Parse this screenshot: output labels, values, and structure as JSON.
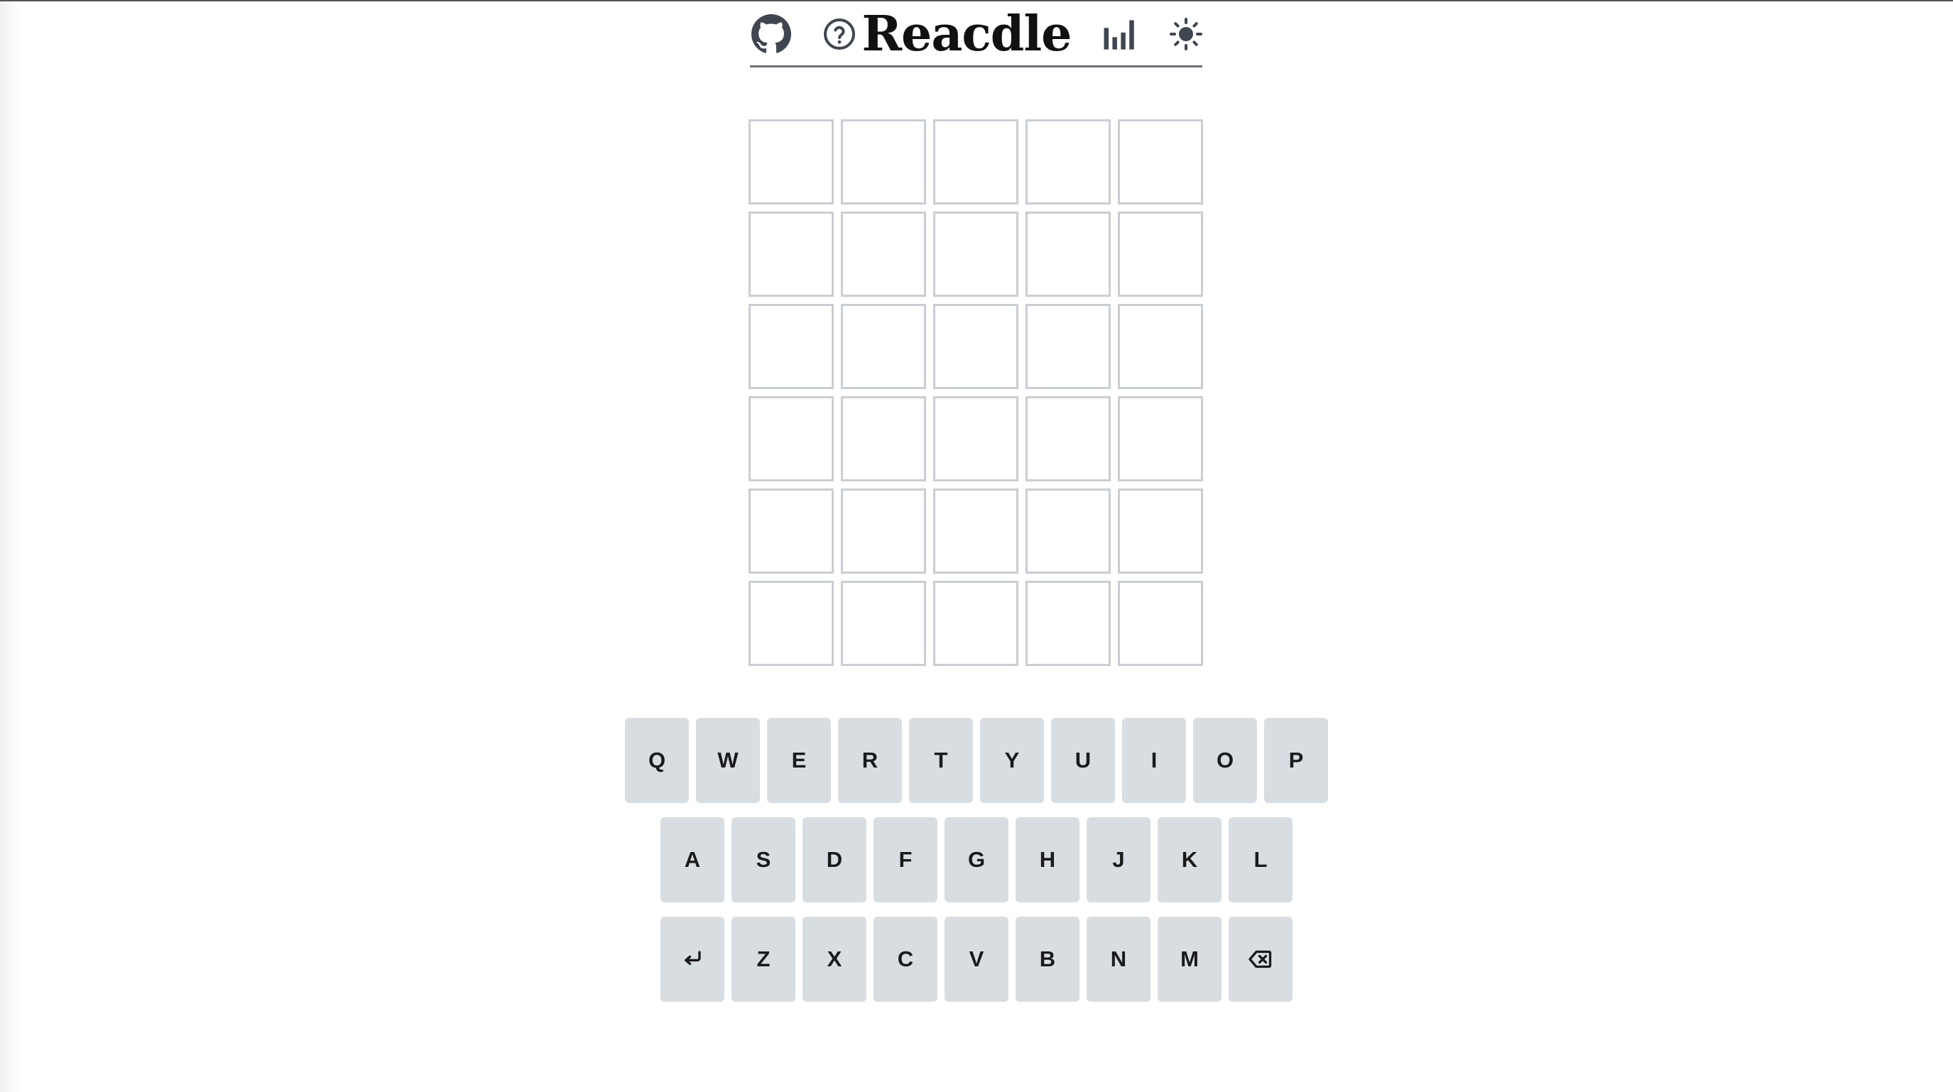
{
  "header": {
    "title": "Reacdle",
    "icons": [
      "github-icon",
      "help-icon",
      "stats-icon",
      "sun-icon"
    ]
  },
  "board": {
    "rows": 6,
    "columns": 5,
    "guesses": [
      [
        "",
        "",
        "",
        "",
        ""
      ],
      [
        "",
        "",
        "",
        "",
        ""
      ],
      [
        "",
        "",
        "",
        "",
        ""
      ],
      [
        "",
        "",
        "",
        "",
        ""
      ],
      [
        "",
        "",
        "",
        "",
        ""
      ],
      [
        "",
        "",
        "",
        "",
        ""
      ]
    ]
  },
  "keyboard": {
    "row1": [
      "Q",
      "W",
      "E",
      "R",
      "T",
      "Y",
      "U",
      "I",
      "O",
      "P"
    ],
    "row2": [
      "A",
      "S",
      "D",
      "F",
      "G",
      "H",
      "J",
      "K",
      "L"
    ],
    "row3": [
      "Z",
      "X",
      "C",
      "V",
      "B",
      "N",
      "M"
    ],
    "enter_icon": "enter-icon",
    "backspace_icon": "backspace-icon"
  },
  "colors": {
    "tile_border": "#c9ced4",
    "key_background": "#d8dde2",
    "icon": "#3f4650",
    "header_rule": "#6b7078"
  }
}
